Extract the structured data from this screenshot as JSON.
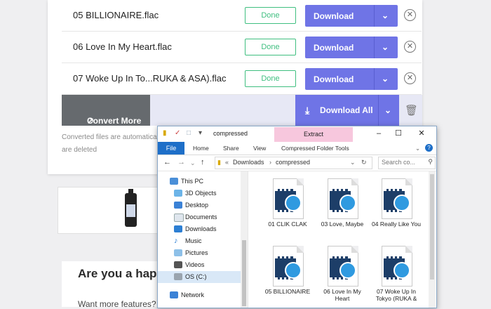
{
  "converter": {
    "files": [
      {
        "name": "05 BILLIONAIRE.flac",
        "status": "Done",
        "action": "Download"
      },
      {
        "name": "06 Love In My Heart.flac",
        "status": "Done",
        "action": "Download"
      },
      {
        "name": "07 Woke Up In To...RUKA & ASA).flac",
        "status": "Done",
        "action": "Download"
      }
    ],
    "convert_more": "Convert More",
    "download_all": "Download All",
    "note_line1": "Converted files are automatica",
    "note_line2": "are deleted"
  },
  "promo": {
    "heading": "Are you a happy",
    "subtext": "Want more features?"
  },
  "explorer": {
    "title": "compressed",
    "context_tab": "Extract",
    "window_controls": [
      "–",
      "☐",
      "✕"
    ],
    "ribbon_tabs": [
      "File",
      "Home",
      "Share",
      "View",
      "Compressed Folder Tools"
    ],
    "address": {
      "prefix": "«",
      "crumb1": "Downloads",
      "sep": "›",
      "crumb2": "compressed"
    },
    "search_placeholder": "Search co...",
    "tree": [
      "This PC",
      "3D Objects",
      "Desktop",
      "Documents",
      "Downloads",
      "Music",
      "Pictures",
      "Videos",
      "OS (C:)",
      "Network"
    ],
    "items": [
      "01 CLIK CLAK",
      "03 Love, Maybe",
      "04 Really Like You",
      "05 BILLIONAIRE",
      "06 Love In My Heart",
      "07 Woke Up In Tokyo (RUKA &"
    ]
  }
}
